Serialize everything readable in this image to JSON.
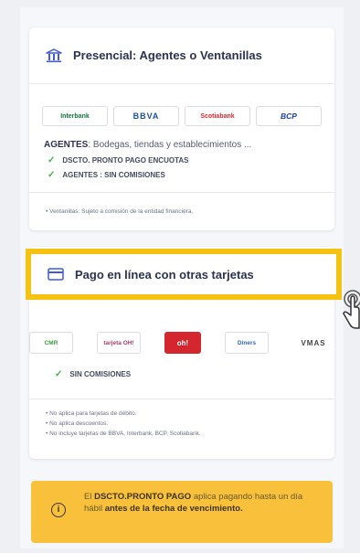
{
  "card_presencial": {
    "title": "Presencial: Agentes o Ventanillas",
    "icon": "bank-icon",
    "banks": [
      "Interbank",
      "BBVA",
      "Scotiabank",
      "BCP"
    ],
    "agents_label": "AGENTES",
    "agents_text": ": Bodegas, tiendas y establecimientos ...",
    "checks": [
      "DSCTO. PRONTO PAGO ENCUOTAS",
      "AGENTES : SIN COMISIONES"
    ],
    "note": "Ventanillas: Sujeto a comisión de la entidad financiera."
  },
  "card_online": {
    "title": "Pago en línea con otras tarjetas",
    "icon": "credit-card-icon",
    "highlight_color": "#f5c211",
    "logos": [
      "CMR",
      "tarjeta OH!",
      "oh!",
      "Diners",
      "VMAS"
    ],
    "check": "SIN COMISIONES",
    "notes": [
      "No aplica para tarjetas de débito.",
      "No aplica descuentos.",
      "No incluye tarjetas de BBVA, Interbank, BCP, Scotiabank."
    ]
  },
  "warning": {
    "pre": "El ",
    "bold1": "DSCTO.PRONTO PAGO",
    "mid": " aplica pagando hasta un día hábil ",
    "bold2": "antes de la fecha de vencimiento.",
    "icon": "info-icon",
    "color": "#f8c03b"
  }
}
